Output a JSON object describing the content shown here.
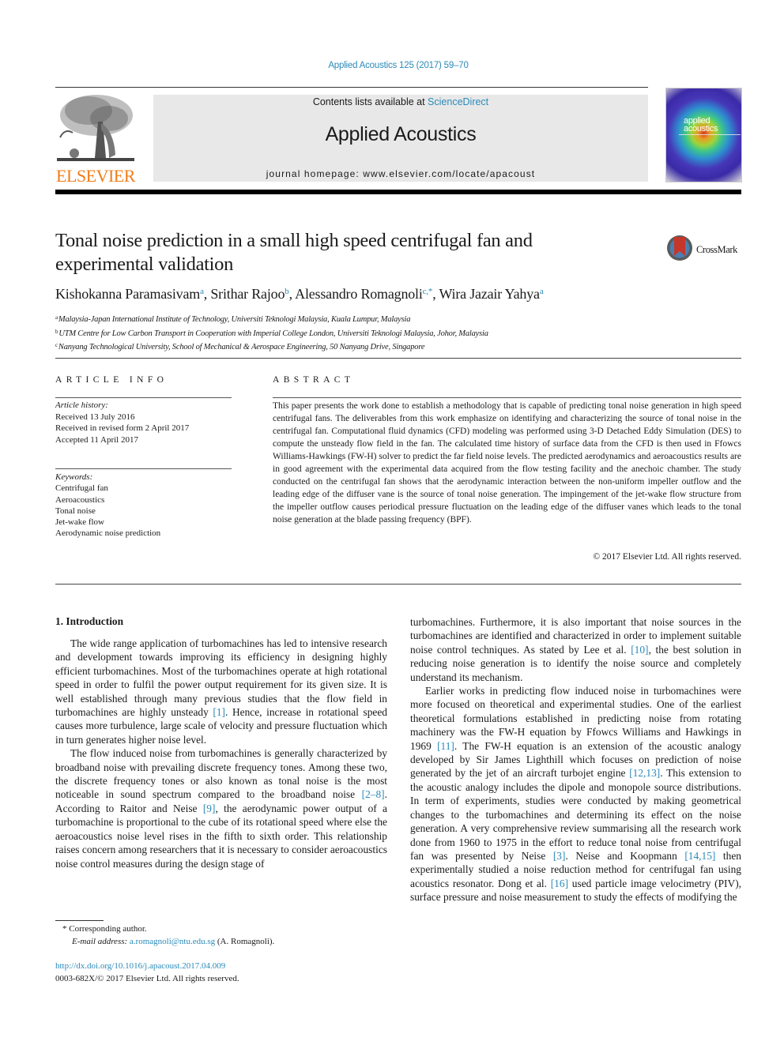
{
  "journal_reference": "Applied Acoustics 125 (2017) 59–70",
  "masthead": {
    "contents_prefix": "Contents lists available at ",
    "contents_link": "ScienceDirect",
    "journal_title": "Applied Acoustics",
    "homepage": "journal homepage: www.elsevier.com/locate/apacoust"
  },
  "publisher_logo_text": "ELSEVIER",
  "cover": {
    "line1": "applied",
    "line2": "acoustics"
  },
  "crossmark_label": "CrossMark",
  "article": {
    "title": "Tonal noise prediction in a small high speed centrifugal fan and experimental validation",
    "authors": [
      {
        "name": "Kishokanna Paramasivam",
        "affil": "a"
      },
      {
        "name": "Srithar Rajoo",
        "affil": "b"
      },
      {
        "name": "Alessandro Romagnoli",
        "affil": "c,*"
      },
      {
        "name": "Wira Jazair Yahya",
        "affil": "a"
      }
    ],
    "affiliations": [
      {
        "key": "a",
        "text": "Malaysia-Japan International Institute of Technology, Universiti Teknologi Malaysia, Kuala Lumpur, Malaysia"
      },
      {
        "key": "b",
        "text": "UTM Centre for Low Carbon Transport in Cooperation with Imperial College London, Universiti Teknologi Malaysia, Johor, Malaysia"
      },
      {
        "key": "c",
        "text": "Nanyang Technological University, School of Mechanical & Aerospace Engineering, 50 Nanyang Drive, Singapore"
      }
    ]
  },
  "article_info": {
    "heading": "ARTICLE INFO",
    "history_label": "Article history:",
    "history": [
      "Received 13 July 2016",
      "Received in revised form 2 April 2017",
      "Accepted 11 April 2017"
    ],
    "keywords_label": "Keywords:",
    "keywords": [
      "Centrifugal fan",
      "Aeroacoustics",
      "Tonal noise",
      "Jet-wake flow",
      "Aerodynamic noise prediction"
    ]
  },
  "abstract": {
    "heading": "ABSTRACT",
    "text": "This paper presents the work done to establish a methodology that is capable of predicting tonal noise generation in high speed centrifugal fans. The deliverables from this work emphasize on identifying and characterizing the source of tonal noise in the centrifugal fan. Computational fluid dynamics (CFD) modeling was performed using 3-D Detached Eddy Simulation (DES) to compute the unsteady flow field in the fan. The calculated time history of surface data from the CFD is then used in Ffowcs Williams-Hawkings (FW-H) solver to predict the far field noise levels. The predicted aerodynamics and aeroacoustics results are in good agreement with the experimental data acquired from the flow testing facility and the anechoic chamber. The study conducted on the centrifugal fan shows that the aerodynamic interaction between the non-uniform impeller outflow and the leading edge of the diffuser vane is the source of tonal noise generation. The impingement of the jet-wake flow structure from the impeller outflow causes periodical pressure fluctuation on the leading edge of the diffuser vanes which leads to the tonal noise generation at the blade passing frequency (BPF).",
    "copyright": "© 2017 Elsevier Ltd. All rights reserved."
  },
  "body": {
    "section_heading": "1. Introduction",
    "left_paragraphs": [
      [
        {
          "t": "The wide range application of turbomachines has led to intensive research and development towards improving its efficiency in designing highly efficient turbomachines. Most of the turbomachines operate at high rotational speed in order to fulfil the power output requirement for its given size. It is well established through many previous studies that the flow field in turbomachines are highly unsteady "
        },
        {
          "c": "[1]"
        },
        {
          "t": ". Hence, increase in rotational speed causes more turbulence, large scale of velocity and pressure fluctuation which in turn generates higher noise level."
        }
      ],
      [
        {
          "t": "The flow induced noise from turbomachines is generally characterized by broadband noise with prevailing discrete frequency tones. Among these two, the discrete frequency tones or also known as tonal noise is the most noticeable in sound spectrum compared to the broadband noise "
        },
        {
          "c": "[2–8]"
        },
        {
          "t": ". According to Raitor and Neise "
        },
        {
          "c": "[9]"
        },
        {
          "t": ", the aerodynamic power output of a turbomachine is proportional to the cube of its rotational speed where else the aeroacoustics noise level rises in the fifth to sixth order. This relationship raises concern among researchers that it is necessary to consider aeroacoustics noise control measures during the design stage of"
        }
      ]
    ],
    "right_paragraphs": [
      [
        {
          "t": "turbomachines. Furthermore, it is also important that noise sources in the turbomachines are identified and characterized in order to implement suitable noise control techniques. As stated by Lee et al. "
        },
        {
          "c": "[10]"
        },
        {
          "t": ", the best solution in reducing noise generation is to identify the noise source and completely understand its mechanism."
        }
      ],
      [
        {
          "t": "Earlier works in predicting flow induced noise in turbomachines were more focused on theoretical and experimental studies. One of the earliest theoretical formulations established in predicting noise from rotating machinery was the FW-H equation by Ffowcs Williams and Hawkings in 1969 "
        },
        {
          "c": "[11]"
        },
        {
          "t": ". The FW-H equation is an extension of the acoustic analogy developed by Sir James Lighthill which focuses on prediction of noise generated by the jet of an aircraft turbojet engine "
        },
        {
          "c": "[12,13]"
        },
        {
          "t": ". This extension to the acoustic analogy includes the dipole and monopole source distributions. In term of experiments, studies were conducted by making geometrical changes to the turbomachines and determining its effect on the noise generation. A very comprehensive review summarising all the research work done from 1960 to 1975 in the effort to reduce tonal noise from centrifugal fan was presented by Neise "
        },
        {
          "c": "[3]"
        },
        {
          "t": ". Neise and Koopmann "
        },
        {
          "c": "[14,15]"
        },
        {
          "t": " then experimentally studied a noise reduction method for centrifugal fan using acoustics resonator. Dong et al. "
        },
        {
          "c": "[16]"
        },
        {
          "t": " used particle image velocimetry (PIV), surface pressure and noise measurement to study the effects of modifying the"
        }
      ]
    ]
  },
  "footnotes": {
    "marker": "*",
    "corresponding": "Corresponding author.",
    "email_label": "E-mail address:",
    "email": "a.romagnoli@ntu.edu.sg",
    "email_suffix": "(A. Romagnoli).",
    "doi": "http://dx.doi.org/10.1016/j.apacoust.2017.04.009",
    "issn_copyright": "0003-682X/© 2017 Elsevier Ltd. All rights reserved."
  }
}
